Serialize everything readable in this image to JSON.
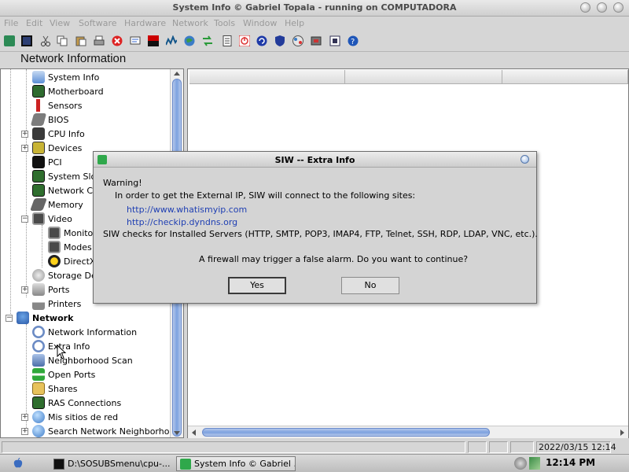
{
  "window": {
    "title": "System Info  © Gabriel Topala - running on COMPUTADORA"
  },
  "menu": [
    "File",
    "Edit",
    "View",
    "Software",
    "Hardware",
    "Network",
    "Tools",
    "Window",
    "Help"
  ],
  "panel": {
    "title": "Network Information"
  },
  "tree": {
    "items": [
      {
        "label": "System Info",
        "icon": "monitor-icon"
      },
      {
        "label": "Motherboard",
        "icon": "motherboard-icon"
      },
      {
        "label": "Sensors",
        "icon": "thermometer-icon"
      },
      {
        "label": "BIOS",
        "icon": "chip-icon"
      },
      {
        "label": "CPU Info",
        "icon": "cpu-icon"
      },
      {
        "label": "Devices",
        "icon": "devices-icon"
      },
      {
        "label": "PCI",
        "icon": "pci-icon"
      },
      {
        "label": "System Slo",
        "icon": "slot-icon"
      },
      {
        "label": "Network Ca",
        "icon": "network-card-icon"
      },
      {
        "label": "Memory",
        "icon": "memory-icon"
      },
      {
        "label": "Video",
        "icon": "video-icon"
      },
      {
        "label": "Monitor",
        "icon": "monitor-icon"
      },
      {
        "label": "Modes",
        "icon": "modes-icon"
      },
      {
        "label": "DirectX",
        "icon": "directx-icon"
      },
      {
        "label": "Storage De",
        "icon": "storage-icon"
      },
      {
        "label": "Ports",
        "icon": "ports-icon"
      },
      {
        "label": "Printers",
        "icon": "printer-icon"
      },
      {
        "label": "Network",
        "icon": "network-icon"
      },
      {
        "label": "Network Information",
        "icon": "info-icon"
      },
      {
        "label": "Extra Info",
        "icon": "info-icon"
      },
      {
        "label": "Neighborhood Scan",
        "icon": "scan-icon"
      },
      {
        "label": "Open Ports",
        "icon": "ports-arrows-icon"
      },
      {
        "label": "Shares",
        "icon": "folder-icon"
      },
      {
        "label": "RAS Connections",
        "icon": "ras-icon"
      },
      {
        "label": "Mis sitios de red",
        "icon": "globe-icon"
      },
      {
        "label": "Search Network Neighborhood",
        "icon": "globe-icon"
      }
    ]
  },
  "status": {
    "datetime": "2022/03/15 12:14"
  },
  "taskbar": {
    "task1": "D:\\SOSUBSmenu\\cpu-...",
    "task2": "System Info  © Gabriel ...",
    "clock": "12:14 PM"
  },
  "dialog": {
    "title": "SIW -- Extra Info",
    "warning": "Warning!",
    "line1": "In order to get the External IP, SIW will connect to the following sites:",
    "link1": "http://www.whatismyip.com",
    "link2": "http://checkip.dyndns.org",
    "line2": "SIW checks for Installed Servers (HTTP, SMTP, POP3, IMAP4, FTP, Telnet, SSH, RDP, LDAP, VNC, etc.).",
    "question": "A firewall may trigger a false alarm. Do you want to continue?",
    "yes": "Yes",
    "no": "No"
  }
}
